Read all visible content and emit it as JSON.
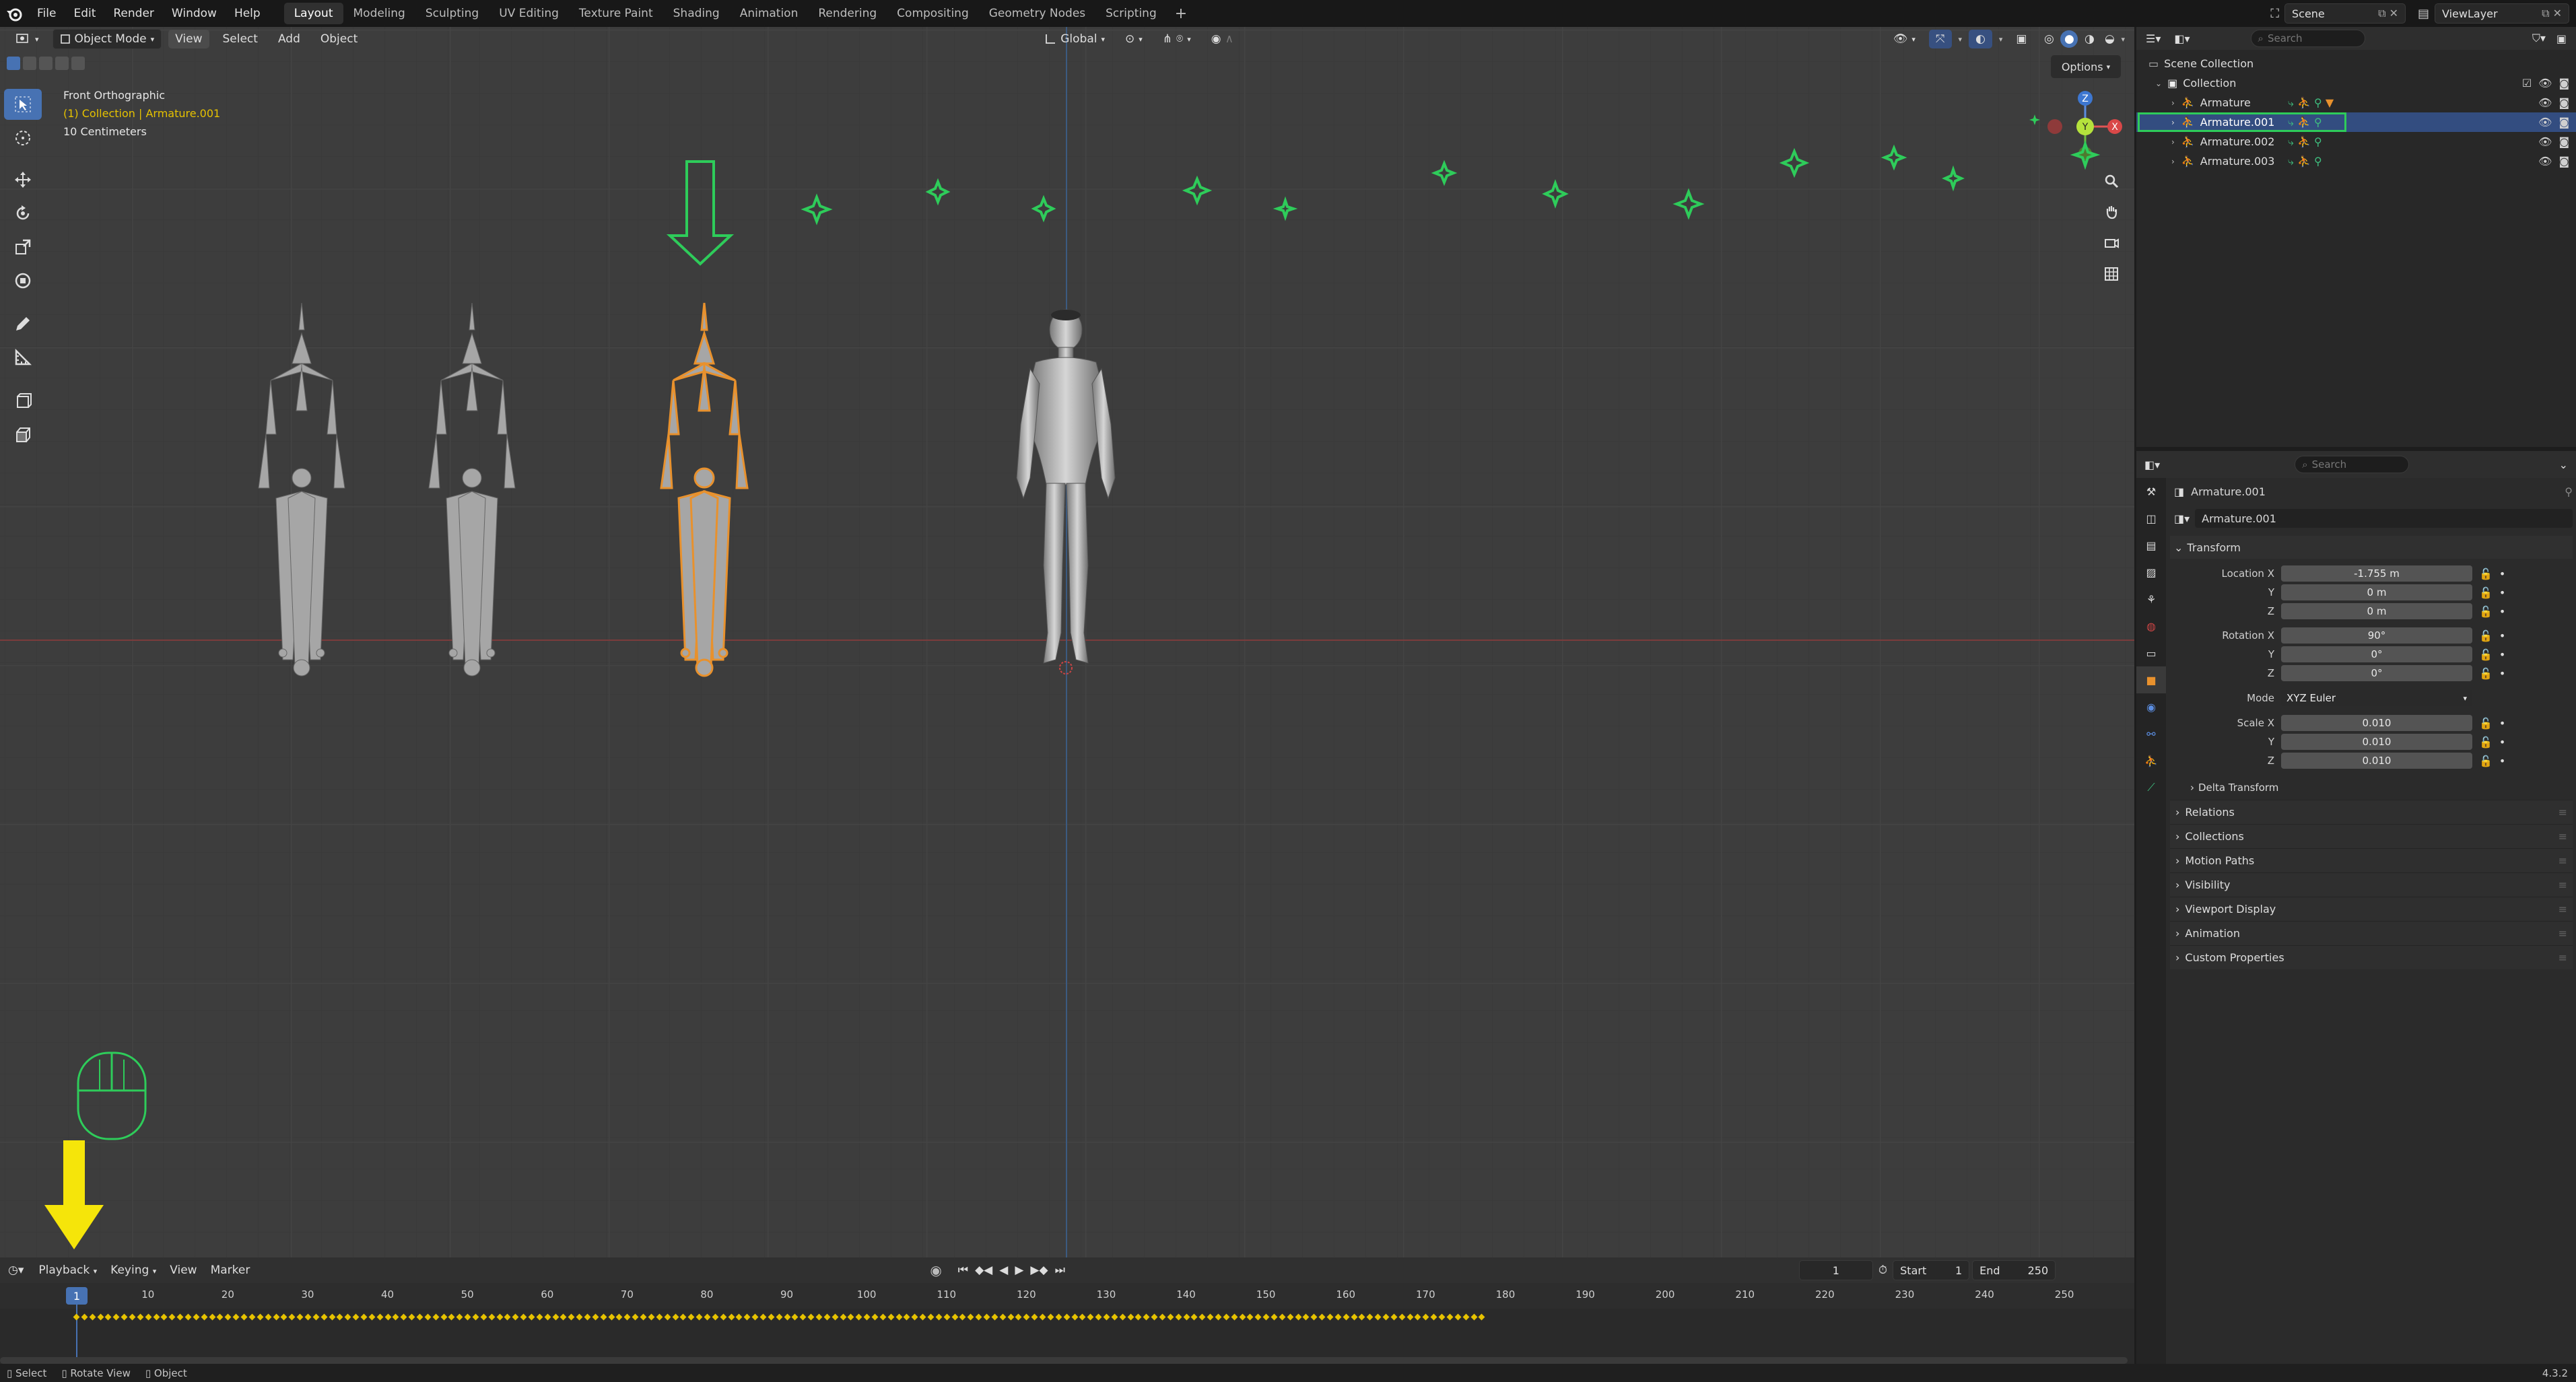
{
  "menu": {
    "items": [
      "File",
      "Edit",
      "Render",
      "Window",
      "Help"
    ],
    "workspaces": [
      "Layout",
      "Modeling",
      "Sculpting",
      "UV Editing",
      "Texture Paint",
      "Shading",
      "Animation",
      "Rendering",
      "Compositing",
      "Geometry Nodes",
      "Scripting"
    ],
    "active_workspace": "Layout",
    "scene": "Scene",
    "view_layer": "ViewLayer"
  },
  "viewport": {
    "mode": "Object Mode",
    "menus": [
      "View",
      "Select",
      "Add",
      "Object"
    ],
    "orientation": "Global",
    "view_name": "Front Orthographic",
    "collection_path": "(1) Collection | Armature.001",
    "grid_unit": "10 Centimeters",
    "options_label": "Options",
    "gizmo_axes": {
      "z": "Z",
      "y": "Y",
      "x": "X"
    }
  },
  "outliner": {
    "search_placeholder": "Search",
    "root": "Scene Collection",
    "collection": "Collection",
    "objects": [
      {
        "name": "Armature",
        "selected": false
      },
      {
        "name": "Armature.001",
        "selected": true
      },
      {
        "name": "Armature.002",
        "selected": false
      },
      {
        "name": "Armature.003",
        "selected": false
      }
    ]
  },
  "properties": {
    "search_placeholder": "Search",
    "object_name": "Armature.001",
    "datablock_name": "Armature.001",
    "transform_title": "Transform",
    "location_label": "Location X",
    "location": [
      "-1.755 m",
      "0 m",
      "0 m"
    ],
    "rotation_label": "Rotation X",
    "rotation": [
      "90°",
      "0°",
      "0°"
    ],
    "mode_label": "Mode",
    "mode": "XYZ Euler",
    "scale_label": "Scale X",
    "scale": [
      "0.010",
      "0.010",
      "0.010"
    ],
    "axis_y": "Y",
    "axis_z": "Z",
    "delta": "Delta Transform",
    "sections": [
      "Relations",
      "Collections",
      "Motion Paths",
      "Visibility",
      "Viewport Display",
      "Animation",
      "Custom Properties"
    ]
  },
  "timeline": {
    "menus": [
      "Playback",
      "Keying",
      "View",
      "Marker"
    ],
    "current_frame": "1",
    "start_label": "Start",
    "start": "1",
    "end_label": "End",
    "end": "250",
    "ruler_ticks": [
      "10",
      "20",
      "30",
      "40",
      "50",
      "60",
      "70",
      "80",
      "90",
      "100",
      "110",
      "120",
      "130",
      "140",
      "150",
      "160",
      "170",
      "180",
      "190",
      "200",
      "210",
      "220",
      "230",
      "240",
      "250"
    ],
    "keyframe_end": 177
  },
  "status": {
    "items": [
      "Select",
      "Rotate View",
      "Object"
    ],
    "version": "4.3.2"
  },
  "colors": {
    "accent": "#4772b3",
    "selection": "#e8912d",
    "annotation_green": "#2ecc5a",
    "annotation_yellow": "#f5e50a",
    "keyframe": "#e6c200"
  }
}
